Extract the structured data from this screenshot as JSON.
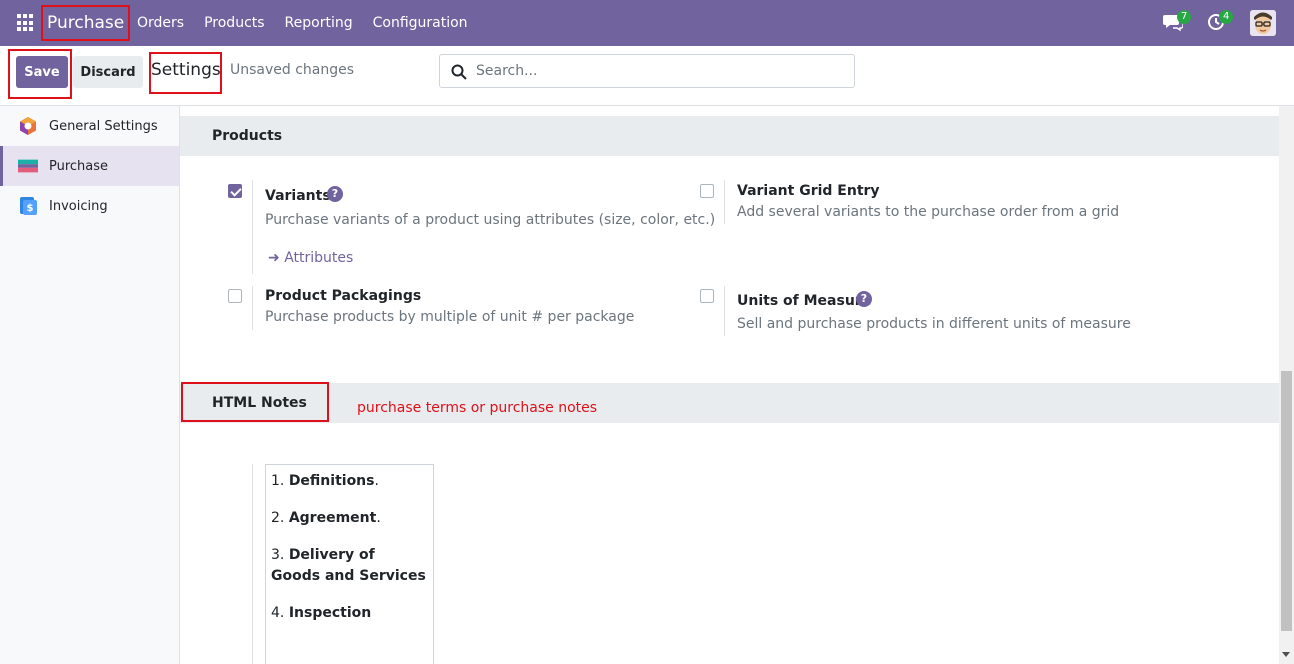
{
  "navbar": {
    "app_name": "Purchase",
    "menu": [
      "Orders",
      "Products",
      "Reporting",
      "Configuration"
    ],
    "chat_count": "7",
    "activity_count": "4"
  },
  "control_panel": {
    "save_label": "Save",
    "discard_label": "Discard",
    "title": "Settings",
    "status": "Unsaved changes",
    "search_placeholder": "Search..."
  },
  "sidebar": {
    "items": [
      {
        "label": "General Settings",
        "icon": "general-settings-icon"
      },
      {
        "label": "Purchase",
        "icon": "purchase-app-icon",
        "active": true
      },
      {
        "label": "Invoicing",
        "icon": "invoicing-app-icon"
      }
    ]
  },
  "products_section": {
    "title": "Products",
    "settings": [
      {
        "title": "Variants",
        "description": "Purchase variants of a product using attributes (size, color, etc.)",
        "checked": true,
        "help": true,
        "link": "Attributes"
      },
      {
        "title": "Variant Grid Entry",
        "description": "Add several variants to the purchase order from a grid",
        "checked": false
      },
      {
        "title": "Product Packagings",
        "description": "Purchase products by multiple of unit # per package",
        "checked": false
      },
      {
        "title": "Units of Measure",
        "description": "Sell and purchase products in different units of measure",
        "checked": false,
        "help": true
      }
    ]
  },
  "html_notes_section": {
    "title": "HTML Notes",
    "annotation": "purchase terms or purchase notes",
    "notes": [
      {
        "num": "1.",
        "text": "Definitions",
        "suffix": "."
      },
      {
        "num": "2.",
        "text": "Agreement",
        "suffix": "."
      },
      {
        "num": "3.",
        "text": "Delivery of Goods and Services",
        "suffix": ""
      },
      {
        "num": "4.",
        "text": "Inspection",
        "suffix": ""
      }
    ]
  },
  "colors": {
    "brand": "#71639e",
    "annotation_red": "#e0101a",
    "badge_green": "#28a745"
  }
}
